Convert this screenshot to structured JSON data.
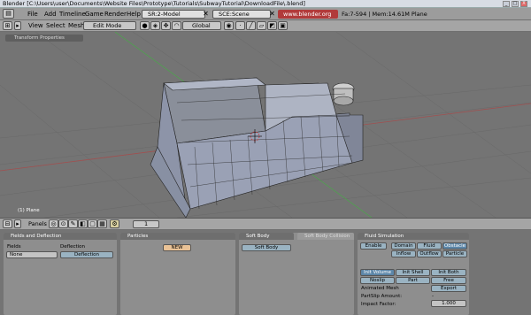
{
  "window": {
    "title": "Blender [C:\\Users\\user\\Documents\\Website Files\\Prototype\\Tutorials\\SubwayTutorial\\DownloadFile\\.blend]",
    "min": "_",
    "max": "□",
    "close": "X"
  },
  "menubar": {
    "items": [
      "File",
      "Add",
      "Timeline",
      "Game",
      "Render",
      "Help"
    ],
    "screen": "SR:2-Model",
    "scene": "SCE:Scene",
    "url": "www.blender.org 245",
    "stats": "Fa:7-594 | Mem:14.61M Plane"
  },
  "view3d_header": {
    "menus": [
      "View",
      "Select",
      "Mesh"
    ],
    "mode": "Edit Mode",
    "orientation": "Global"
  },
  "viewport": {
    "transform_properties": "Transform Properties",
    "object_label": "(1) Plane"
  },
  "buttons_header": {
    "panels_label": "Panels",
    "frame": "1"
  },
  "panels": {
    "fields": {
      "title": "Fields and Deflection",
      "fields_label": "Fields",
      "deflection_label": "Deflection",
      "fields_value": "None",
      "deflection_button": "Deflection"
    },
    "particles": {
      "title": "Particles",
      "new_button": "NEW"
    },
    "softbody": {
      "tab1": "Soft Body",
      "tab2": "Soft Body Collision",
      "button": "Soft Body"
    },
    "fluid": {
      "title": "Fluid Simulation",
      "enable": "Enable",
      "types": [
        "Domain",
        "Fluid",
        "Obstacle",
        "Inflow",
        "Outflow",
        "Particle"
      ],
      "init": [
        "Init Volume",
        "Init Shell",
        "Init Both"
      ],
      "slip": [
        "Noslip",
        "Part",
        "Free"
      ],
      "animated_mesh": "Animated Mesh",
      "export": "Export",
      "partslip": "PartSlip Amount:",
      "partslip_value": "-",
      "impact": "Impact Factor:",
      "impact_value": "1.000"
    }
  }
}
